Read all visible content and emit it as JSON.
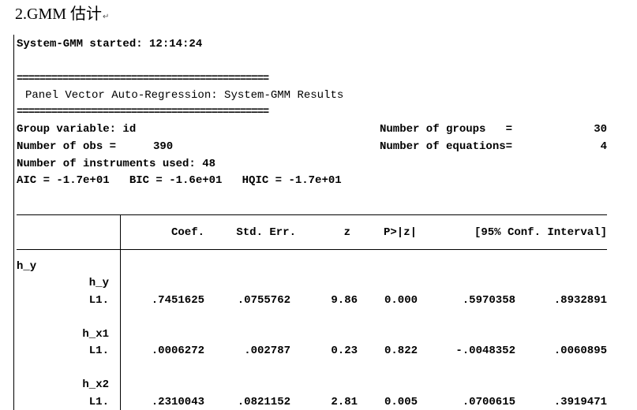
{
  "heading": {
    "text": "2.GMM 估计",
    "mark": "↵"
  },
  "log": {
    "started": "System-GMM started: 12:14:24",
    "rule": "============================================",
    "title": "Panel Vector Auto-Regression: System-GMM Results"
  },
  "stats": {
    "group_variable": "Group variable: id",
    "num_groups_label": "Number of groups   =",
    "num_groups_value": "30",
    "num_obs_label": "Number of obs =",
    "num_obs_value": "390",
    "num_eq_label": "Number of equations=",
    "num_eq_value": "4",
    "instruments": "Number of instruments used: 48",
    "ic_line": "AIC = -1.7e+01   BIC = -1.6e+01   HQIC = -1.7e+01"
  },
  "table": {
    "headers": {
      "coef": "Coef.",
      "se": "Std. Err.",
      "z": "z",
      "p": "P>|z|",
      "ci": "[95% Conf. Interval]"
    },
    "equation": "h_y",
    "rows": [
      {
        "var": "h_y",
        "lag": "L1.",
        "coef": ".7451625",
        "se": ".0755762",
        "z": "9.86",
        "p": "0.000",
        "ci_low": ".5970358",
        "ci_high": ".8932891"
      },
      {
        "var": "h_x1",
        "lag": "L1.",
        "coef": ".0006272",
        "se": ".002787",
        "z": "0.23",
        "p": "0.822",
        "ci_low": "-.0048352",
        "ci_high": ".0060895"
      },
      {
        "var": "h_x2",
        "lag": "L1.",
        "coef": ".2310043",
        "se": ".0821152",
        "z": "2.81",
        "p": "0.005",
        "ci_low": ".0700615",
        "ci_high": ".3919471"
      }
    ]
  }
}
